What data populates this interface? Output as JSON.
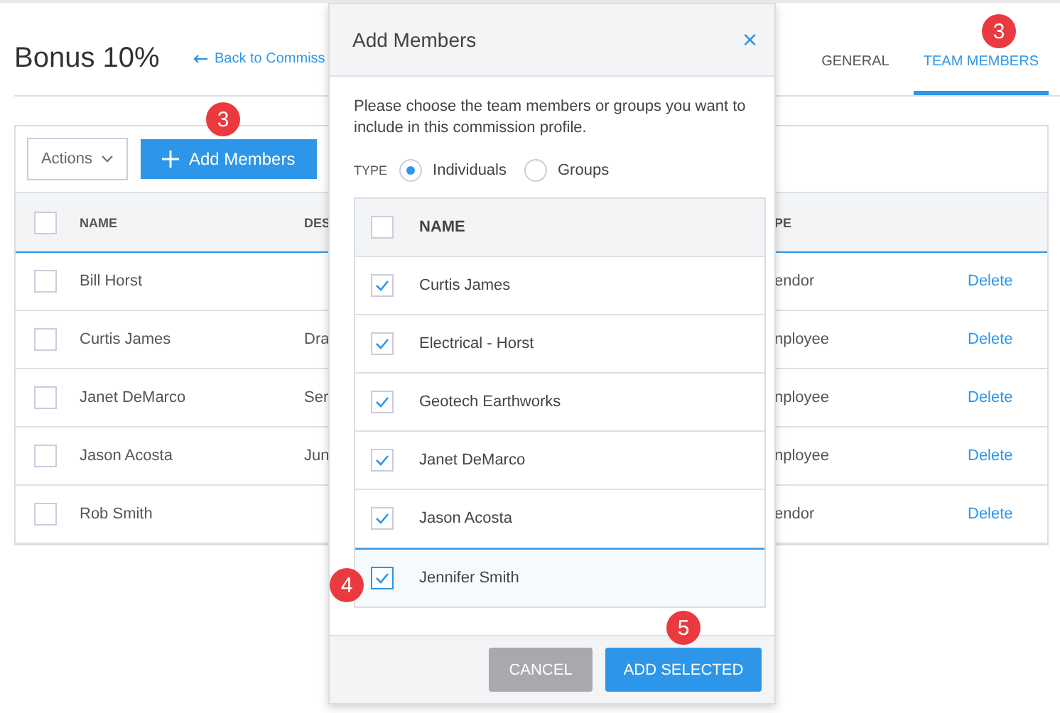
{
  "page": {
    "title": "Bonus 10%",
    "back_link": "Back to Commiss",
    "tabs": [
      {
        "label": "GENERAL",
        "selected": false
      },
      {
        "label": "TEAM MEMBERS",
        "selected": true
      }
    ]
  },
  "toolbar": {
    "actions": "Actions",
    "add_button": "Add Members"
  },
  "table": {
    "select_all_checked": false,
    "columns": [
      "NAME",
      "DES",
      "PE"
    ],
    "rows": [
      {
        "name": "Bill Horst",
        "column_2": "",
        "column_3": "endor",
        "action": "Delete",
        "checked": false
      },
      {
        "name": "Curtis James",
        "column_2": "Dra",
        "column_3": "nployee",
        "action": "Delete",
        "checked": false
      },
      {
        "name": "Janet DeMarco",
        "column_2": "Ser",
        "column_3": "nployee",
        "action": "Delete",
        "checked": false
      },
      {
        "name": "Jason Acosta",
        "column_2": "Jun",
        "column_3": "nployee",
        "action": "Delete",
        "checked": false
      },
      {
        "name": "Rob Smith",
        "column_2": "",
        "column_3": "endor",
        "action": "Delete",
        "checked": false
      }
    ]
  },
  "dialog": {
    "title": "Add Members",
    "close": "×",
    "description": "Please choose the team members or groups you want to include in this commission profile.",
    "type_label": "TYPE",
    "type_options": [
      {
        "label": "Individuals",
        "selected": true
      },
      {
        "label": "Groups",
        "selected": false
      }
    ],
    "select_all_checked": false,
    "column": "NAME",
    "members": [
      {
        "name": "Curtis James",
        "checked": true,
        "selected": false
      },
      {
        "name": "Electrical - Horst",
        "checked": true,
        "selected": false
      },
      {
        "name": "Geotech Earthworks",
        "checked": true,
        "selected": false
      },
      {
        "name": "Janet DeMarco",
        "checked": true,
        "selected": false
      },
      {
        "name": "Jason Acosta",
        "checked": true,
        "selected": false
      },
      {
        "name": "Jennifer Smith",
        "checked": true,
        "selected": true
      }
    ],
    "buttons": [
      {
        "label": "CANCEL",
        "kind": "secondary"
      },
      {
        "label": "ADD SELECTED",
        "kind": "primary"
      }
    ]
  },
  "annotations": [
    "3",
    "3",
    "4",
    "5"
  ]
}
